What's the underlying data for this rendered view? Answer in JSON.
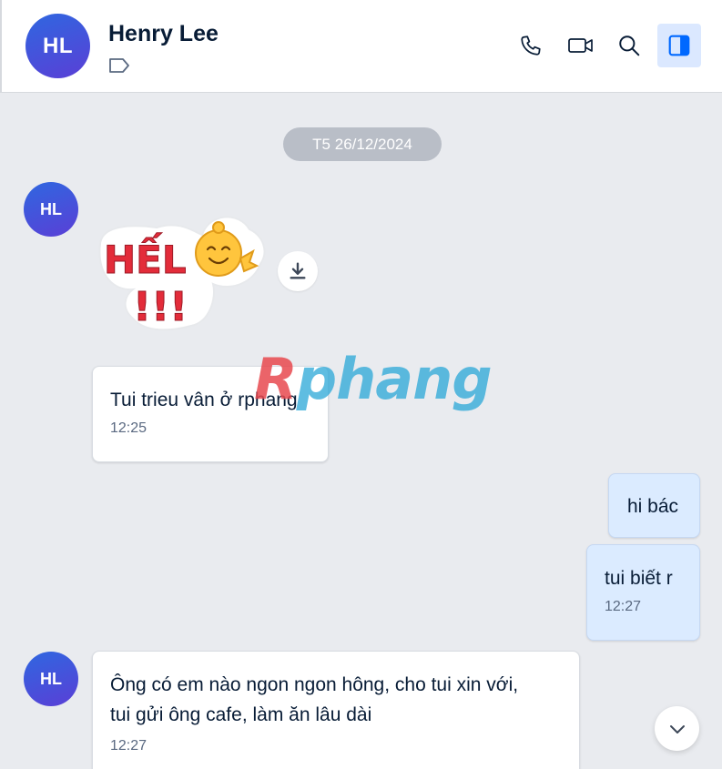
{
  "header": {
    "avatar_initials": "HL",
    "contact_name": "Henry Lee",
    "icons": [
      "tag-icon",
      "phone-icon",
      "video-call-icon",
      "search-icon",
      "sidebar-toggle-icon"
    ]
  },
  "conversation": {
    "date_separator": "T5 26/12/2024",
    "messages": [
      {
        "side": "in",
        "avatar_initials": "HL",
        "type": "sticker",
        "sticker_text": "HẾLÔ !!!"
      },
      {
        "side": "in",
        "text": "Tui trieu vân ở rphang",
        "time": "12:25"
      },
      {
        "side": "out",
        "text": "hi bác"
      },
      {
        "side": "out",
        "text": "tui biết r",
        "time": "12:27"
      },
      {
        "side": "in",
        "avatar_initials": "HL",
        "text_line1": "Ông có em nào ngon ngon hông, cho tui xin với,",
        "text_line2": "tui gửi ông cafe, làm ăn lâu dài",
        "time": "12:27"
      }
    ]
  },
  "watermark": {
    "first_letter": "R",
    "rest": "phang"
  },
  "colors": {
    "accent": "#0068ff",
    "avatar_gradient_start": "#2f67e0",
    "avatar_gradient_end": "#5a3fd6",
    "outgoing_bubble": "#dbebff",
    "background": "#e9ebef"
  }
}
